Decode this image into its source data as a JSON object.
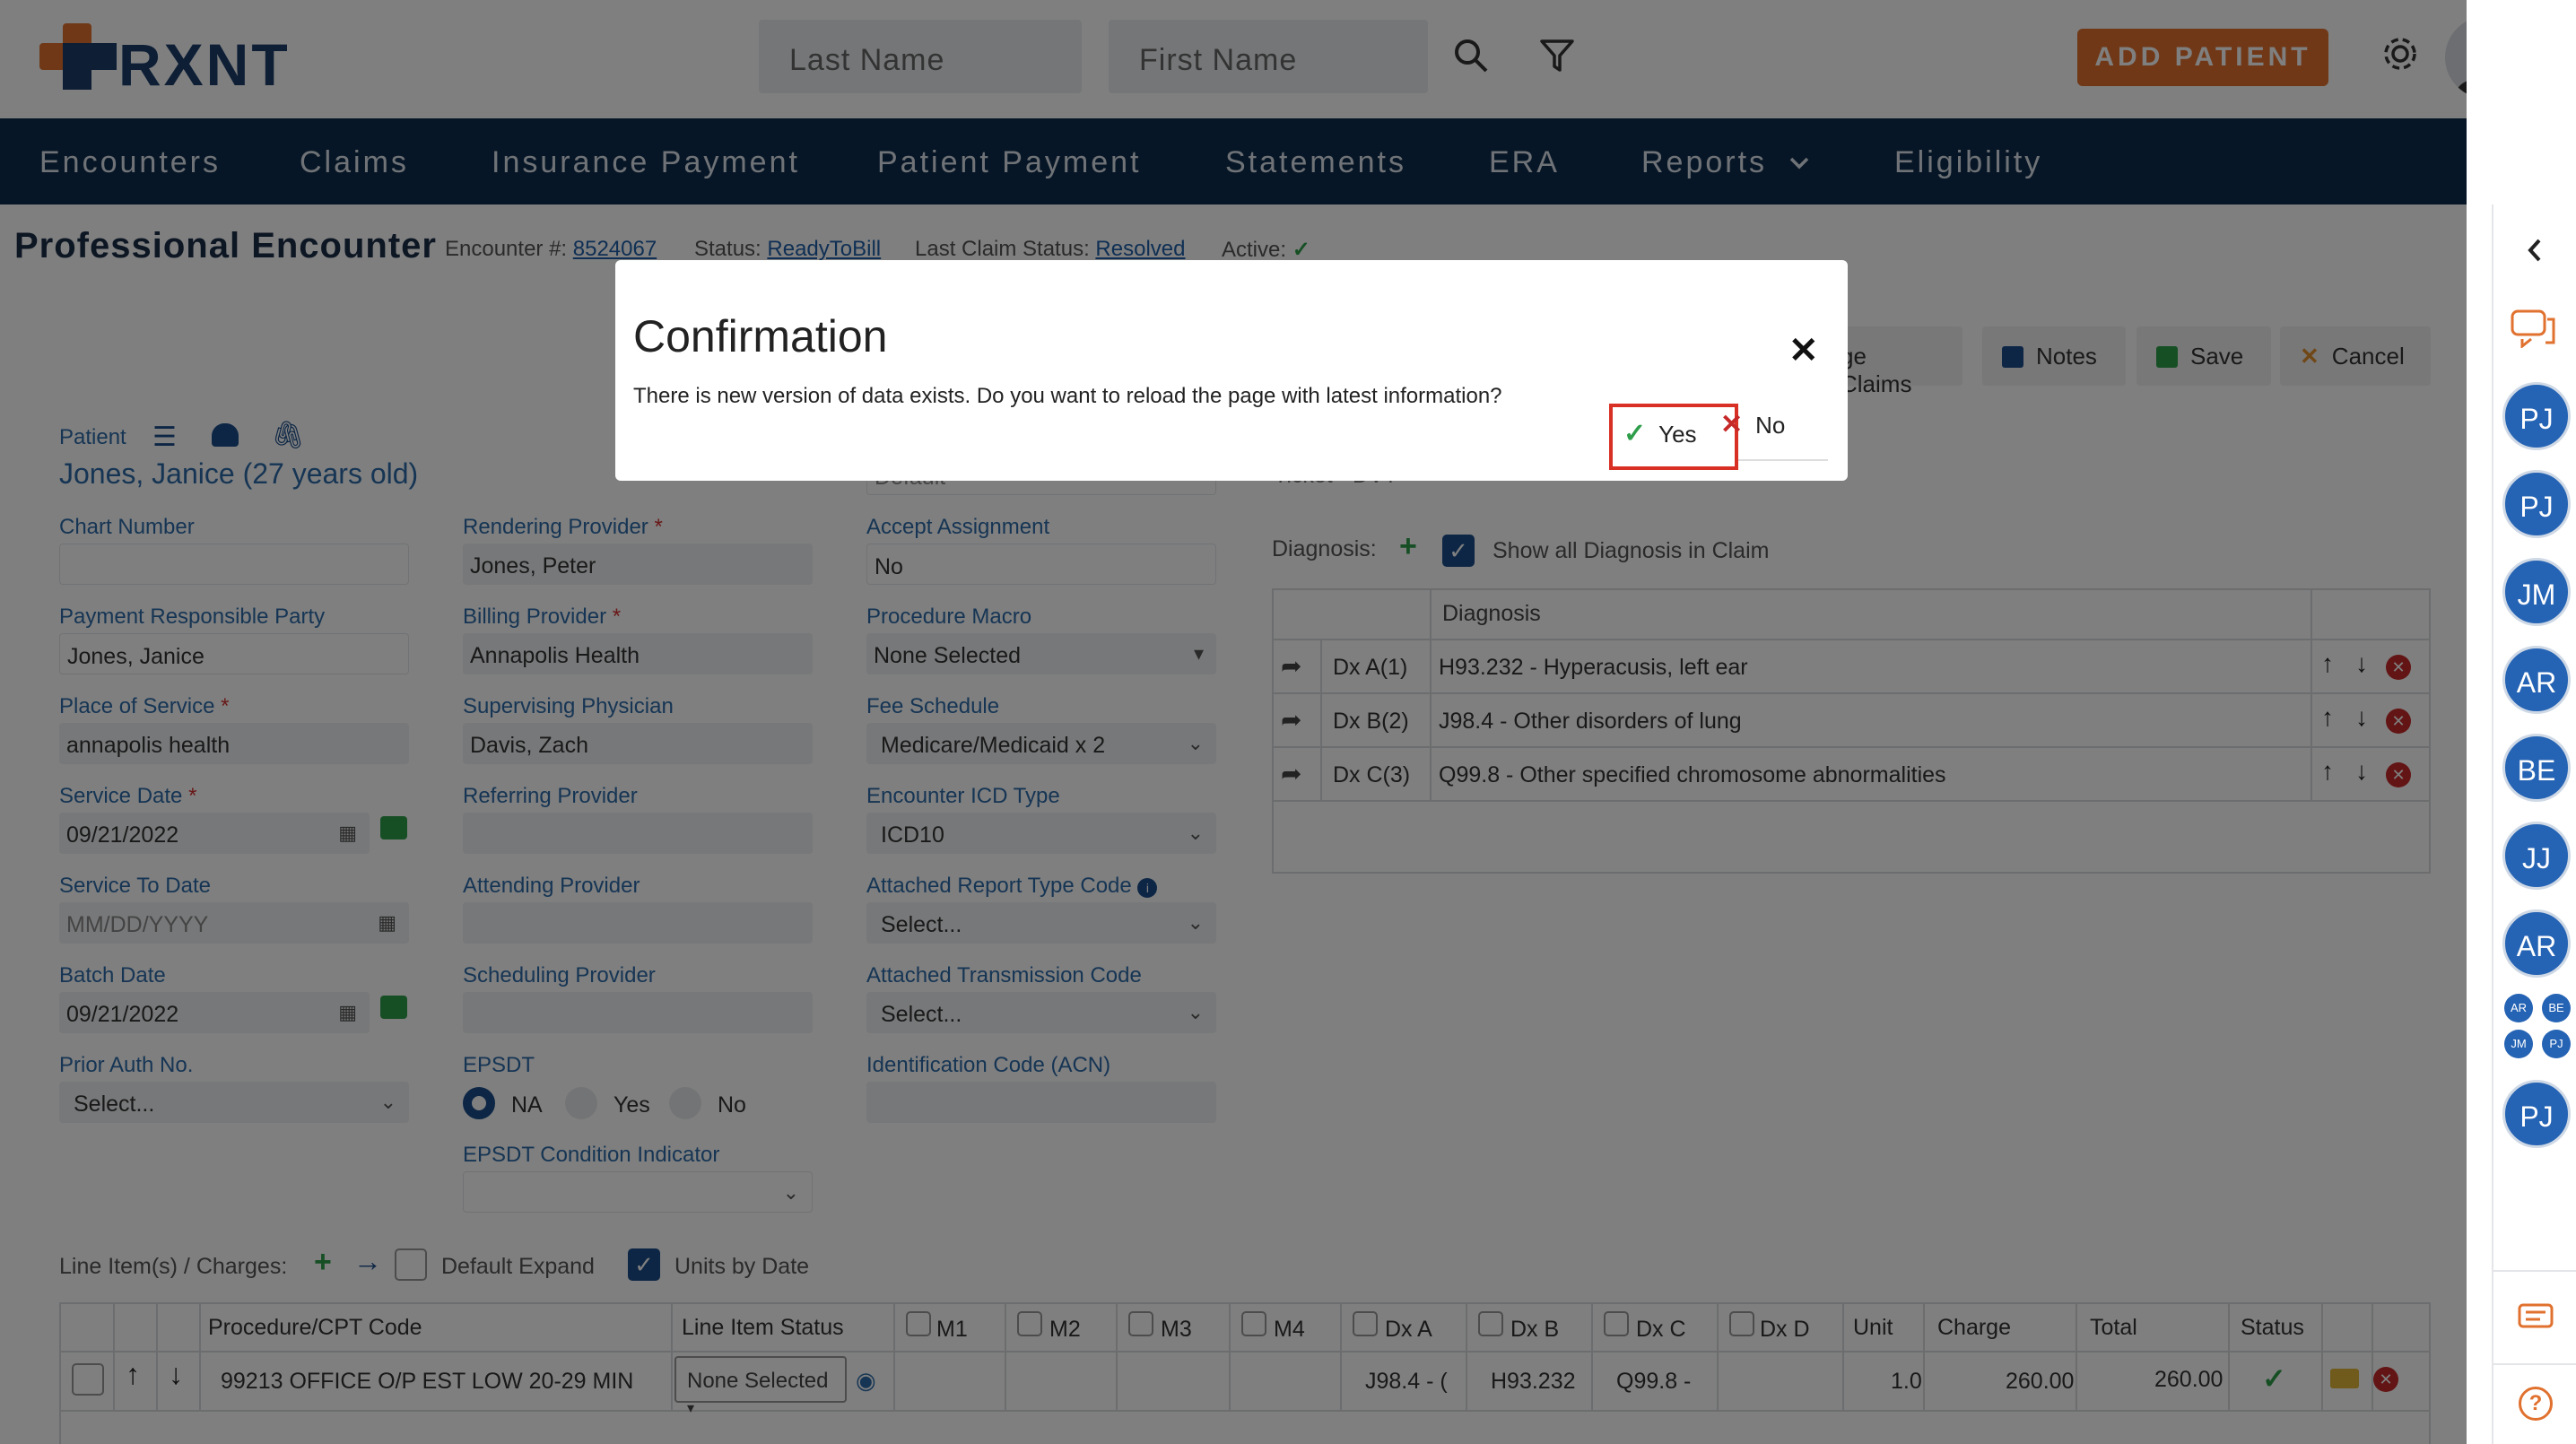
{
  "header": {
    "brand": "RXNT",
    "search_last_placeholder": "Last Name",
    "search_first_placeholder": "First Name",
    "add_patient": "ADD PATIENT"
  },
  "nav": {
    "items": [
      "Encounters",
      "Claims",
      "Insurance Payment",
      "Patient Payment",
      "Statements",
      "ERA",
      "Reports",
      "Eligibility"
    ]
  },
  "encounter": {
    "title": "Professional Encounter",
    "encounter_label": "Encounter #:",
    "encounter_no": "8524067",
    "status_label": "Status:",
    "status": "ReadyToBill",
    "last_claim_label": "Last Claim Status:",
    "last_claim": "Resolved",
    "active_label": "Active:"
  },
  "toolbar": {
    "claims": "ge Claims",
    "notes": "Notes",
    "save": "Save",
    "cancel": "Cancel"
  },
  "patient": {
    "label": "Patient",
    "name": "Jones, Janice (27 years old)"
  },
  "form": {
    "chart_number_label": "Chart Number",
    "chart_number": "",
    "payment_party_label": "Payment Responsible Party",
    "payment_party": "Jones, Janice",
    "place_label": "Place of Service",
    "place": "annapolis health",
    "service_date_label": "Service Date",
    "service_date": "09/21/2022",
    "service_to_label": "Service To Date",
    "service_to_placeholder": "MM/DD/YYYY",
    "batch_date_label": "Batch Date",
    "batch_date": "09/21/2022",
    "prior_auth_label": "Prior Auth No.",
    "prior_auth": "Select...",
    "rendering_label": "Rendering Provider",
    "rendering": "Jones, Peter",
    "billing_label": "Billing Provider",
    "billing": "Annapolis Health",
    "supervising_label": "Supervising Physician",
    "supervising": "Davis, Zach",
    "referring_label": "Referring Provider",
    "attending_label": "Attending Provider",
    "scheduling_label": "Scheduling Provider",
    "epsdt_label": "EPSDT",
    "epsdt_options": [
      "NA",
      "Yes",
      "No"
    ],
    "epsdt_selected": "NA",
    "epsdt_cond_label": "EPSDT Condition Indicator",
    "default_partial": "Default",
    "accept_label": "Accept Assignment",
    "accept": "No",
    "macro_label": "Procedure Macro",
    "macro": "None Selected",
    "fee_label": "Fee Schedule",
    "fee": "Medicare/Medicaid x 2",
    "icd_label": "Encounter ICD Type",
    "icd": "ICD10",
    "report_type_label": "Attached Report Type Code",
    "report_type": "Select...",
    "transmission_label": "Attached Transmission Code",
    "transmission": "Select...",
    "acn_label": "Identification Code (ACN)",
    "partial_right": "Ticket - DVT"
  },
  "diagnosis": {
    "label": "Diagnosis:",
    "show_all": "Show all Diagnosis in Claim",
    "header": "Diagnosis",
    "rows": [
      {
        "code": "Dx A(1)",
        "desc": "H93.232 - Hyperacusis, left ear"
      },
      {
        "code": "Dx B(2)",
        "desc": "J98.4 - Other disorders of lung"
      },
      {
        "code": "Dx C(3)",
        "desc": "Q99.8 - Other specified chromosome abnormalities"
      }
    ]
  },
  "lines": {
    "label": "Line Item(s) / Charges:",
    "default_expand": "Default Expand",
    "units_by_date": "Units by Date",
    "headers": [
      "Procedure/CPT Code",
      "Line Item Status",
      "M1",
      "M2",
      "M3",
      "M4",
      "Dx A",
      "Dx B",
      "Dx C",
      "Dx D",
      "Unit",
      "Charge",
      "Total",
      "Status"
    ],
    "row": {
      "cpt": "99213 OFFICE O/P EST LOW 20-29 MIN",
      "status": "None Selected",
      "dx_a": "J98.4 - (",
      "dx_b": "H93.232",
      "dx_c": "Q99.8 -",
      "unit": "1.0",
      "charge": "260.00",
      "total": "260.00"
    }
  },
  "modal": {
    "title": "Confirmation",
    "message": "There is new version of data exists. Do you want to reload the page with latest information?",
    "yes": "Yes",
    "no": "No"
  },
  "rail": {
    "avatars": [
      "PJ",
      "PJ",
      "JM",
      "AR",
      "BE",
      "JJ",
      "AR"
    ],
    "group": [
      "AR",
      "BE",
      "JM",
      "PJ"
    ],
    "last": "PJ"
  },
  "colors": {
    "nav_bg": "#0f2c4d",
    "accent": "#e0712f",
    "link": "#1f5fa8",
    "avatar": "#2563b4",
    "highlight": "#d93025"
  }
}
